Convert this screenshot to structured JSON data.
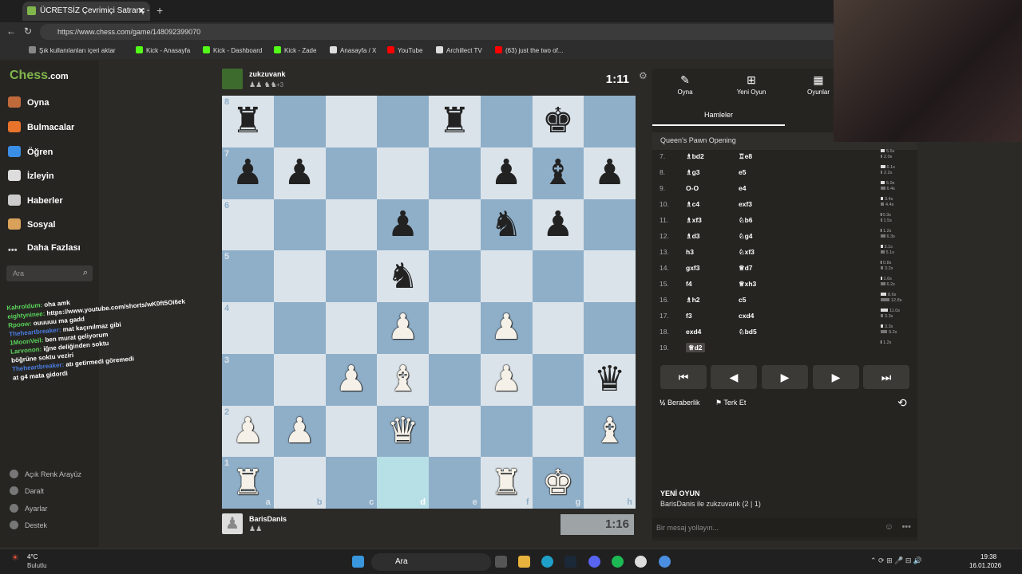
{
  "browser": {
    "tab_title": "ÜCRETSİZ Çevrimiçi Satranç - Ches",
    "url": "https://www.chess.com/game/148092399070",
    "bookmarks": [
      "Şık kullanılanları içeri aktar",
      "Kick - Anasayfa",
      "Kick - Dashboard",
      "Kick - Zade",
      "Anasayfa / X",
      "YouTube",
      "Archillect TV",
      "(63) just the two of..."
    ]
  },
  "sidebar": {
    "logo_a": "Chess",
    "logo_b": ".com",
    "items": [
      "Oyna",
      "Bulmacalar",
      "Öğren",
      "İzleyin",
      "Haberler",
      "Sosyal",
      "Daha Fazlası"
    ],
    "search_placeholder": "Ara",
    "bottom": [
      "Açık Renk Arayüz",
      "Daralt",
      "Ayarlar",
      "Destek"
    ]
  },
  "chat": [
    {
      "user": "Kahroldum:",
      "msg": "oha amk",
      "color": "#5ad45a"
    },
    {
      "user": "eightyninee:",
      "msg": "https://www.youtube.com/shorts/wK0ft5Oi6ek",
      "color": "#5ad45a"
    },
    {
      "user": "Rpoow:",
      "msg": "ouuuuu ma gadd",
      "color": "#5ad45a"
    },
    {
      "user": "Theheartbreaker:",
      "msg": "mat kaçınılmaz gibi",
      "color": "#4a7be0"
    },
    {
      "user": "1MoonVeil:",
      "msg": "ben murat geliyorum",
      "color": "#5ad45a"
    },
    {
      "user": "Larvonon:",
      "msg": "iğne deliğinden soktu",
      "color": "#5ad45a"
    },
    {
      "user": "",
      "msg": "böğrüne soktu veziri",
      "color": "#e04040"
    },
    {
      "user": "Theheartbreaker:",
      "msg": "atı getirmedi göremedi",
      "color": "#4a7be0"
    },
    {
      "user": "",
      "msg": "at g4 mata gidordi",
      "color": "#e04040"
    }
  ],
  "top_player": {
    "name": "zukzuvank",
    "extra": "+3",
    "clock": "1:11"
  },
  "bottom_player": {
    "name": "BarisDanis",
    "clock": "1:16"
  },
  "board": {
    "ranks": [
      "8",
      "7",
      "6",
      "5",
      "4",
      "3",
      "2",
      "1"
    ],
    "files": [
      "a",
      "b",
      "c",
      "d",
      "e",
      "f",
      "g",
      "h"
    ],
    "rows": [
      [
        "br",
        "",
        "",
        "",
        "br",
        "",
        "bk",
        ""
      ],
      [
        "bp",
        "bp",
        "",
        "",
        "",
        "bp",
        "bb",
        "bp"
      ],
      [
        "",
        "",
        "",
        "bp",
        "",
        "bn",
        "bp",
        ""
      ],
      [
        "",
        "",
        "",
        "bn",
        "",
        "",
        "",
        ""
      ],
      [
        "",
        "",
        "",
        "wp",
        "",
        "wp",
        "",
        ""
      ],
      [
        "",
        "",
        "wp",
        "wb",
        "",
        "wp",
        "",
        "bq"
      ],
      [
        "wp",
        "wp",
        "",
        "wq",
        "",
        "",
        "",
        "wb"
      ],
      [
        "wr",
        "",
        "",
        "",
        "",
        "wr",
        "wk",
        ""
      ]
    ],
    "highlight": "d1"
  },
  "panel": {
    "tabs": [
      "Oyna",
      "Yeni Oyun",
      "Oyunlar"
    ],
    "subtab": "Hamleler",
    "opening": "Queen's Pawn Opening",
    "moves": [
      {
        "n": "7.",
        "w": "♗bd2",
        "b": "♖e8",
        "tw": "5.6s",
        "tb": "2.0s",
        "bw": 10,
        "bb": 4
      },
      {
        "n": "8.",
        "w": "♗g3",
        "b": "e5",
        "tw": "6.1s",
        "tb": "2.2s",
        "bw": 11,
        "bb": 4
      },
      {
        "n": "9.",
        "w": "O-O",
        "b": "e4",
        "tw": "5.9s",
        "tb": "6.4s",
        "bw": 10,
        "bb": 11
      },
      {
        "n": "10.",
        "w": "♗c4",
        "b": "exf3",
        "tw": "3.4s",
        "tb": "4.4s",
        "bw": 6,
        "bb": 8
      },
      {
        "n": "11.",
        "w": "♗xf3",
        "b": "♘b6",
        "tw": "0.3s",
        "tb": "1.5s",
        "bw": 1,
        "bb": 3
      },
      {
        "n": "12.",
        "w": "♗d3",
        "b": "♘g4",
        "tw": "1.2s",
        "tb": "6.3s",
        "bw": 2,
        "bb": 11
      },
      {
        "n": "13.",
        "w": "h3",
        "b": "♘xf3",
        "tw": "3.1s",
        "tb": "5.1s",
        "bw": 5,
        "bb": 9
      },
      {
        "n": "14.",
        "w": "gxf3",
        "b": "♕d7",
        "tw": "0.8s",
        "tb": "3.2s",
        "bw": 2,
        "bb": 6
      },
      {
        "n": "15.",
        "w": "f4",
        "b": "♕xh3",
        "tw": "1.6s",
        "tb": "6.2s",
        "bw": 3,
        "bb": 11
      },
      {
        "n": "16.",
        "w": "♗h2",
        "b": "c5",
        "tw": "8.6s",
        "tb": "12.8s",
        "bw": 14,
        "bb": 22
      },
      {
        "n": "17.",
        "w": "f3",
        "b": "cxd4",
        "tw": "11.0s",
        "tb": "3.3s",
        "bw": 18,
        "bb": 6
      },
      {
        "n": "18.",
        "w": "exd4",
        "b": "♘bd5",
        "tw": "3.3s",
        "tb": "9.2s",
        "bw": 6,
        "bb": 16
      },
      {
        "n": "19.",
        "w": "♕d2",
        "b": "",
        "tw": "1.2s",
        "tb": "",
        "bw": 2,
        "bb": 0
      }
    ],
    "nav": [
      "⏮",
      "◀",
      "▶",
      "▶",
      "⏭"
    ],
    "draw": "Beraberlik",
    "resign": "Terk Et",
    "new_game_title": "YENİ OYUN",
    "new_game_sub": "BarisDanis ile zukzuvank (2 | 1)",
    "message_placeholder": "Bir mesaj yollayın..."
  },
  "taskbar": {
    "weather_temp": "4°C",
    "weather_desc": "Bulutlu",
    "search": "Ara",
    "time": "19:38",
    "date": "16.01.2026"
  }
}
